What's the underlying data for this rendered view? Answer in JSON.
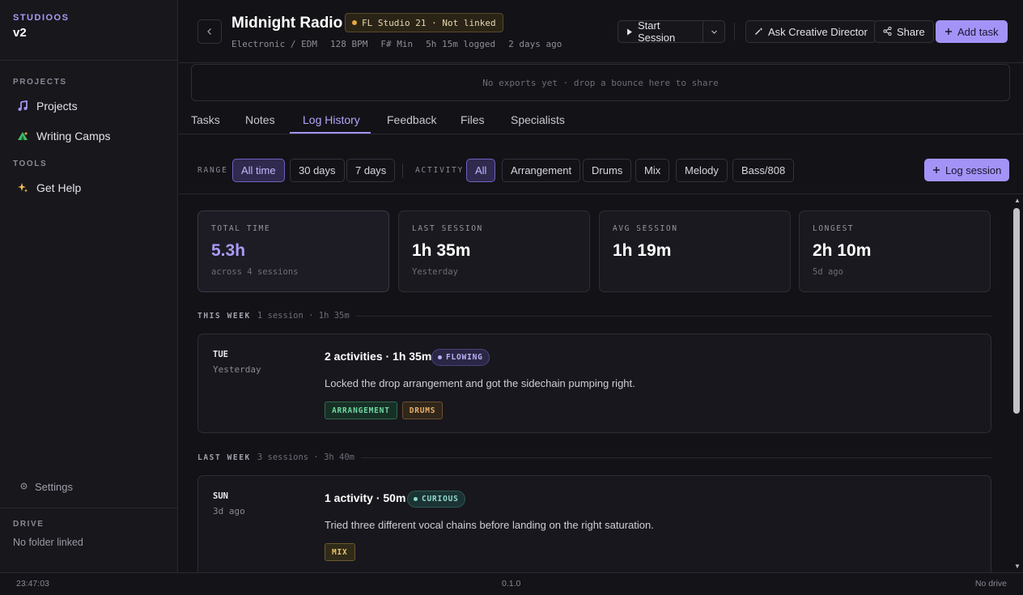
{
  "sidebar": {
    "brand": "STUDIOOS",
    "version": "v2",
    "projects_label": "PROJECTS",
    "tools_label": "TOOLS",
    "items": [
      {
        "label": "Projects",
        "icon": "music-note-icon"
      },
      {
        "label": "Writing Camps",
        "icon": "tent-icon"
      },
      {
        "label": "Get Help",
        "icon": "sparkles-icon"
      }
    ],
    "settings_label": "Settings",
    "drive_label": "DRIVE",
    "drive_value": "No folder linked"
  },
  "header": {
    "title": "Midnight Radio",
    "daw_badge": "FL Studio 21 · Not linked",
    "meta": [
      "Electronic / EDM",
      "128 BPM",
      "F# Min",
      "5h 15m logged",
      "2 days ago"
    ],
    "start_session": "Start Session",
    "ask_director": "Ask Creative Director",
    "share": "Share",
    "add_task": "Add task",
    "exports_placeholder": "No exports yet · drop a bounce here to share"
  },
  "tabs": [
    "Tasks",
    "Notes",
    "Log History",
    "Feedback",
    "Files",
    "Specialists"
  ],
  "active_tab": "Log History",
  "filters": {
    "range_label": "RANGE",
    "range_options": [
      "All time",
      "30 days",
      "7 days"
    ],
    "range_selected": "All time",
    "activity_label": "ACTIVITY",
    "activity_options": [
      "All",
      "Arrangement",
      "Drums",
      "Mix",
      "Melody",
      "Bass/808"
    ],
    "activity_selected": "All",
    "log_session": "Log session"
  },
  "stats": [
    {
      "label": "TOTAL TIME",
      "value": "5.3h",
      "sub": "across 4 sessions"
    },
    {
      "label": "LAST SESSION",
      "value": "1h 35m",
      "sub": "Yesterday"
    },
    {
      "label": "AVG SESSION",
      "value": "1h 19m",
      "sub": ""
    },
    {
      "label": "LONGEST",
      "value": "2h 10m",
      "sub": "5d ago"
    }
  ],
  "weeks": [
    {
      "title": "THIS WEEK",
      "summary": "1 session · 1h 35m",
      "entries": [
        {
          "day": "TUE",
          "when": "Yesterday",
          "title": "2 activities · 1h 35m",
          "mood": "FLOWING",
          "desc": "Locked the drop arrangement and got the sidechain pumping right.",
          "tags": [
            "ARRANGEMENT",
            "DRUMS"
          ]
        }
      ]
    },
    {
      "title": "LAST WEEK",
      "summary": "3 sessions · 3h 40m",
      "entries": [
        {
          "day": "SUN",
          "when": "3d ago",
          "title": "1 activity · 50m",
          "mood": "CURIOUS",
          "desc": "Tried three different vocal chains before landing on the right saturation.",
          "tags": [
            "MIX"
          ]
        }
      ]
    }
  ],
  "footer": {
    "time": "23:47:03",
    "version": "0.1.0",
    "drive": "No drive"
  },
  "colors": {
    "accent": "#a493f7",
    "background": "#131217",
    "flowing": "#b9b0f5",
    "curious": "#8fd8cf",
    "daw_dot": "#e9a640"
  }
}
